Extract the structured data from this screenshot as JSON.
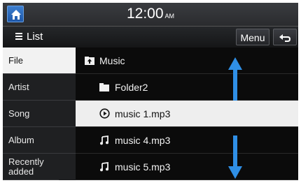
{
  "status_bar": {
    "time": "12:00",
    "ampm": "AM",
    "home_icon": "home-icon"
  },
  "header": {
    "title": "List",
    "menu_label": "Menu",
    "back_icon": "back-arrow-icon"
  },
  "sidebar": {
    "items": [
      {
        "label": "File",
        "active": true
      },
      {
        "label": "Artist",
        "active": false
      },
      {
        "label": "Song",
        "active": false
      },
      {
        "label": "Album",
        "active": false
      },
      {
        "label": "Recently added",
        "active": false
      }
    ]
  },
  "list": {
    "rows": [
      {
        "label": "Music",
        "icon": "folder-up-icon"
      },
      {
        "label": "Folder2",
        "icon": "folder-icon"
      },
      {
        "label": "music 1.mp3",
        "icon": "play-circle-icon",
        "selected": true
      },
      {
        "label": "music 4.mp3",
        "icon": "music-note-icon"
      },
      {
        "label": "music 5.mp3",
        "icon": "music-note-icon"
      }
    ],
    "scroll_up_icon": "scroll-up-arrow-icon",
    "scroll_down_icon": "scroll-down-arrow-icon"
  },
  "colors": {
    "accent": "#2f8fe6",
    "selected_bg": "#eeeeee"
  }
}
